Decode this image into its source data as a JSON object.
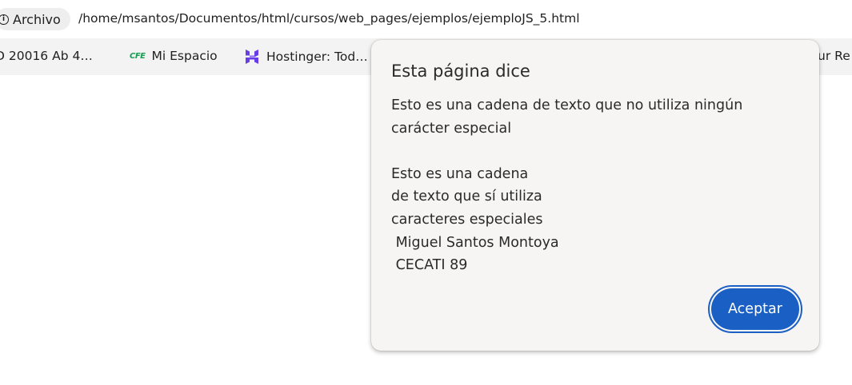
{
  "address_bar": {
    "chip_label": "Archivo",
    "url": "/home/msantos/Documentos/html/cursos/web_pages/ejemplos/ejemploJS_5.html"
  },
  "bookmarks": [
    {
      "label": "D 20016 Ab 4…",
      "icon": "bookmark-icon"
    },
    {
      "label": "Mi Espacio",
      "icon": "cfe-icon",
      "icon_text": "CFE"
    },
    {
      "label": "Hostinger: Tod…",
      "icon": "hostinger-icon"
    },
    {
      "label": "ur Re",
      "icon": ""
    }
  ],
  "dialog": {
    "title": "Esta página dice",
    "message": "Esto es una cadena de texto que no utiliza ningún\ncarácter especial\n\nEsto es una cadena\nde texto que sí utiliza\ncaracteres especiales\n Miguel Santos Montoya\n CECATI 89",
    "ok_label": "Aceptar"
  },
  "colors": {
    "accent": "#1a5fc4",
    "dialog_bg": "#f6f5f4",
    "bookmarks_bg": "#f3f3f3",
    "cfe_green": "#1a9c54",
    "hostinger_purple": "#673de6"
  }
}
